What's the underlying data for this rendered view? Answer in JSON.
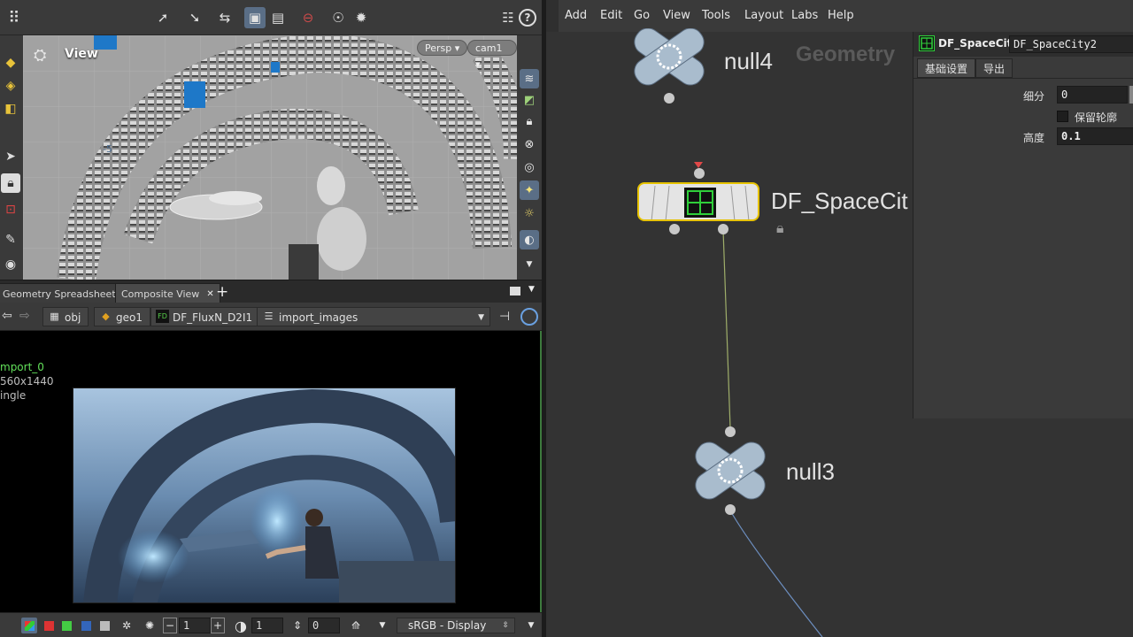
{
  "top_toolbar": {
    "icons": [
      "grip-icon",
      "select-arrow-icon",
      "move-arrow-icon",
      "transform-icon",
      "camera-icon",
      "display-icon",
      "no-entry-icon",
      "snapshot-icon",
      "render-icon",
      "settings-sliders-icon",
      "help-icon"
    ]
  },
  "viewport": {
    "title": "View",
    "perspective": "Persp",
    "camera": "cam1"
  },
  "pane_tabs": [
    {
      "label": "Geometry Spreadsheet"
    },
    {
      "label": "Composite View"
    }
  ],
  "breadcrumbs": [
    "obj",
    "geo1",
    "DF_FluxN_D2I1",
    "import_images"
  ],
  "composite": {
    "node_name": "mport_0",
    "resolution": "560x1440",
    "mode": "ingle"
  },
  "bottom_bar": {
    "field1": "1",
    "field2": "1",
    "field3": "0",
    "colorspace": "sRGB - Display"
  },
  "menu": [
    "Add",
    "Edit",
    "Go",
    "View",
    "Tools",
    "Layout",
    "Labs",
    "Help"
  ],
  "network": {
    "context_label": "Geometry",
    "nodes": {
      "null4": "null4",
      "df": "DF_SpaceCit",
      "null3": "null3"
    }
  },
  "params": {
    "node_type": "DF_SpaceCity",
    "node_name": "DF_SpaceCity2",
    "tabs": [
      "基础设置",
      "导出"
    ],
    "subdiv_label": "细分",
    "subdiv_value": "0",
    "keep_outline_label": "保留轮廓",
    "height_label": "高度",
    "height_value": "0.1"
  },
  "colors": {
    "accent_blue": "#5a6e86",
    "node_blue": "#a9bccd",
    "selected_yellow": "#e6c200",
    "green_text": "#62e05a"
  }
}
